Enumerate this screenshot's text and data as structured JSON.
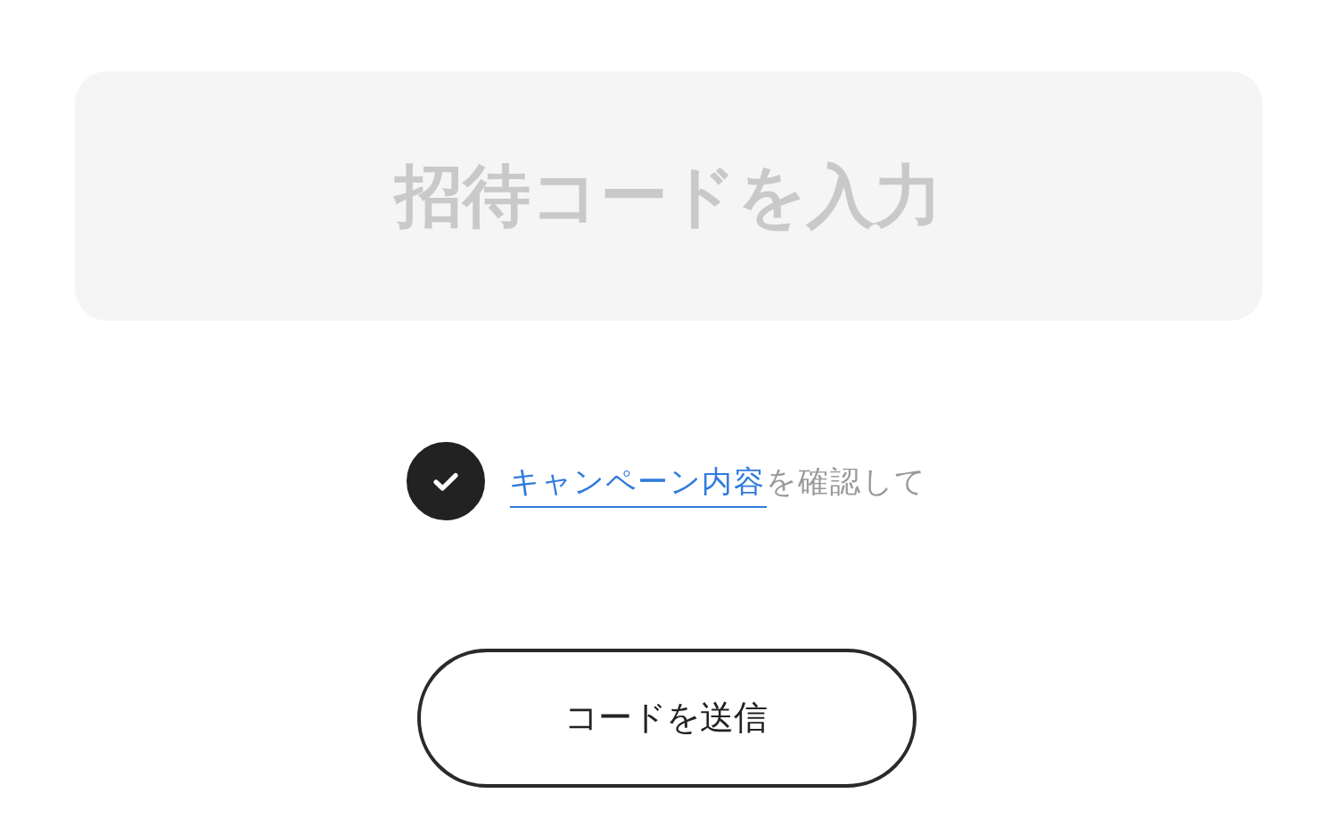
{
  "invite_code_field": {
    "placeholder": "招待コードを入力"
  },
  "consent": {
    "checked": true,
    "link": "キャンペーン内容",
    "text": "を確認して"
  },
  "submit_button": {
    "label": "コードを送信"
  }
}
